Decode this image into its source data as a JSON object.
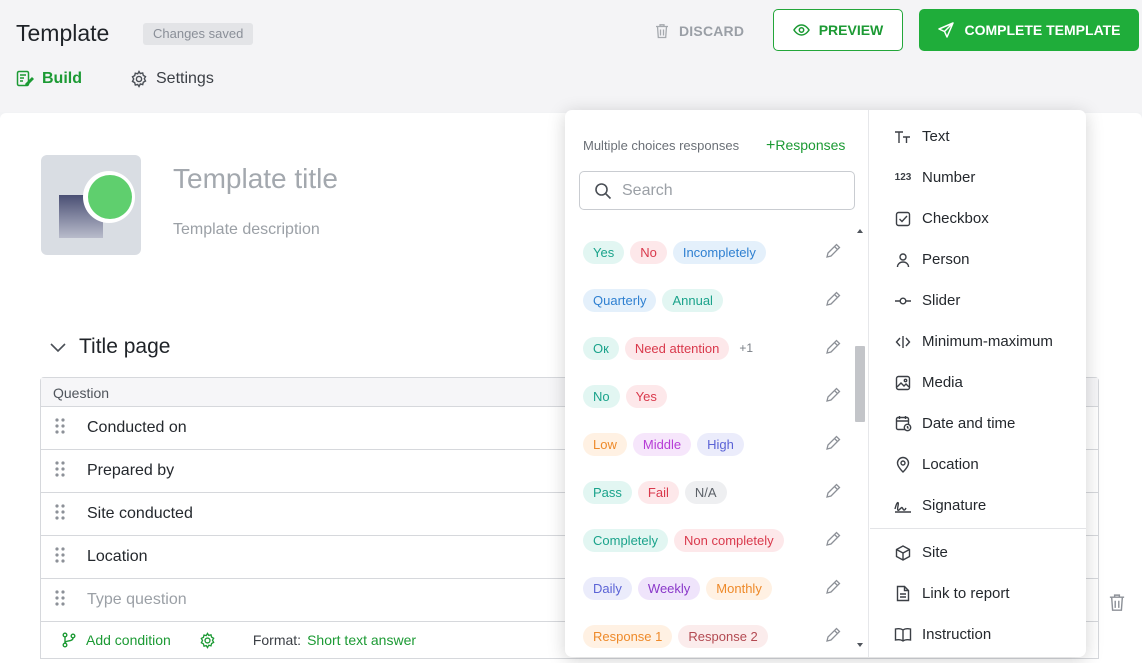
{
  "header": {
    "title": "Template",
    "saved_badge": "Changes saved",
    "discard_label": "DISCARD",
    "preview_label": "PREVIEW",
    "complete_label": "COMPLETE TEMPLATE",
    "tabs": [
      {
        "label": "Build",
        "icon": "build-icon",
        "active": true
      },
      {
        "label": "Settings",
        "icon": "gear-icon",
        "active": false
      }
    ],
    "accent_color": "#1fad3a"
  },
  "template": {
    "title_placeholder": "Template title",
    "description_placeholder": "Template description"
  },
  "section": {
    "title": "Title page",
    "column_header": "Question",
    "rows": [
      "Conducted on",
      "Prepared by",
      "Site conducted",
      "Location"
    ],
    "new_question_placeholder": "Type question",
    "add_condition_label": "Add condition",
    "format_label": "Format:",
    "format_value": "Short text answer"
  },
  "popup": {
    "heading": "Multiple choices responses",
    "add_responses_label": "Responses",
    "search_placeholder": "Search",
    "response_sets": [
      {
        "tags": [
          {
            "t": "Yes",
            "c": "teal"
          },
          {
            "t": "No",
            "c": "red"
          },
          {
            "t": "Incompletely",
            "c": "blue"
          }
        ],
        "more": ""
      },
      {
        "tags": [
          {
            "t": "Quarterly",
            "c": "blue"
          },
          {
            "t": "Annual",
            "c": "teal"
          }
        ],
        "more": ""
      },
      {
        "tags": [
          {
            "t": "Ок",
            "c": "teal"
          },
          {
            "t": "Need attention",
            "c": "red"
          }
        ],
        "more": "+1"
      },
      {
        "tags": [
          {
            "t": "No",
            "c": "teal"
          },
          {
            "t": "Yes",
            "c": "red"
          }
        ],
        "more": ""
      },
      {
        "tags": [
          {
            "t": "Low",
            "c": "orange"
          },
          {
            "t": "Middle",
            "c": "purple"
          },
          {
            "t": "High",
            "c": "indigo"
          }
        ],
        "more": ""
      },
      {
        "tags": [
          {
            "t": "Pass",
            "c": "teal"
          },
          {
            "t": "Fail",
            "c": "red"
          },
          {
            "t": "N/A",
            "c": "gray"
          }
        ],
        "more": ""
      },
      {
        "tags": [
          {
            "t": "Completely",
            "c": "teal"
          },
          {
            "t": "Non completely",
            "c": "red"
          }
        ],
        "more": ""
      },
      {
        "tags": [
          {
            "t": "Daily",
            "c": "indigo"
          },
          {
            "t": "Weekly",
            "c": "violet"
          },
          {
            "t": "Monthly",
            "c": "orange"
          }
        ],
        "more": ""
      },
      {
        "tags": [
          {
            "t": "Response 1",
            "c": "orange"
          },
          {
            "t": "Response 2",
            "c": "rose"
          }
        ],
        "more": ""
      }
    ],
    "types_primary": [
      {
        "label": "Text",
        "icon": "text-icon"
      },
      {
        "label": "Number",
        "icon": "number-icon"
      },
      {
        "label": "Checkbox",
        "icon": "checkbox-icon"
      },
      {
        "label": "Person",
        "icon": "person-icon"
      },
      {
        "label": "Slider",
        "icon": "slider-icon"
      },
      {
        "label": "Minimum-maximum",
        "icon": "min-max-icon"
      },
      {
        "label": "Media",
        "icon": "media-icon"
      },
      {
        "label": "Date and time",
        "icon": "calendar-icon"
      },
      {
        "label": "Location",
        "icon": "location-pin-icon"
      },
      {
        "label": "Signature",
        "icon": "signature-icon"
      }
    ],
    "types_secondary": [
      {
        "label": "Site",
        "icon": "cube-icon"
      },
      {
        "label": "Link to report",
        "icon": "document-icon"
      },
      {
        "label": "Instruction",
        "icon": "book-icon"
      }
    ],
    "tag_colors": {
      "teal": [
        "#e2f6f2",
        "#1aa38b"
      ],
      "red": [
        "#fde8ea",
        "#d9394c"
      ],
      "blue": [
        "#e4f0fb",
        "#2f80d1"
      ],
      "orange": [
        "#fff1e3",
        "#ee8a2a"
      ],
      "purple": [
        "#f6e6fb",
        "#b63cd6"
      ],
      "indigo": [
        "#ebecfb",
        "#5b63d6"
      ],
      "gray": [
        "#eeeff1",
        "#5c6168"
      ],
      "violet": [
        "#efe4fb",
        "#8a37c9"
      ],
      "rose": [
        "#fbecec",
        "#b34a52"
      ]
    }
  }
}
